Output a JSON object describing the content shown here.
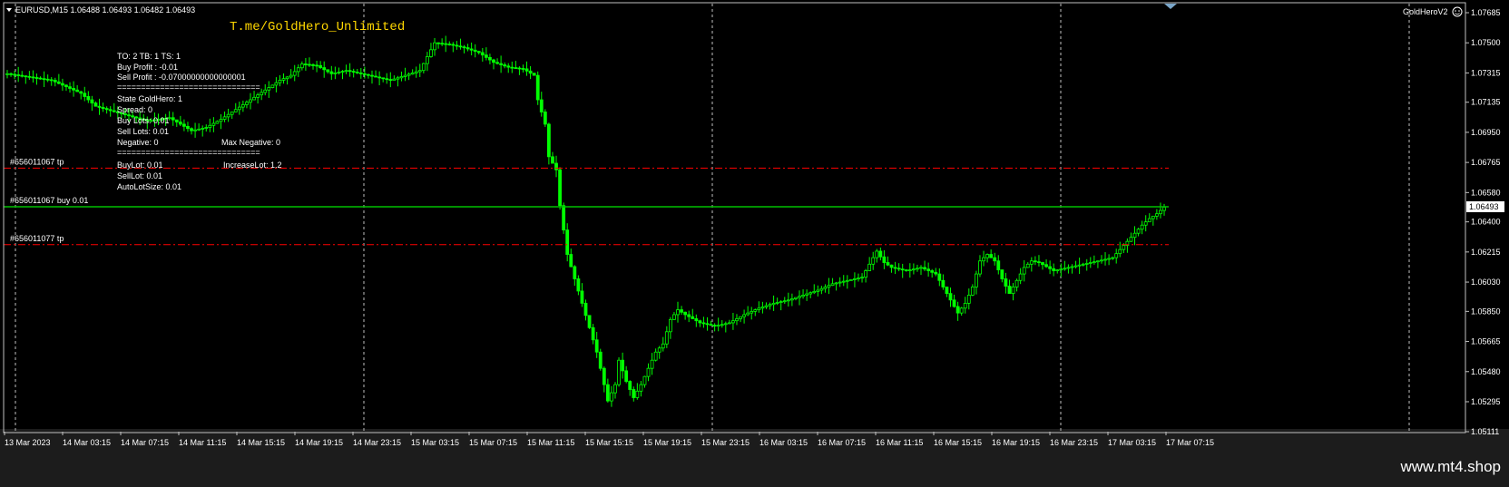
{
  "window": {
    "symbol_line": "EURUSD,M15  1.06488 1.06493 1.06482 1.06493",
    "watermark": "T.me/GoldHero_Unlimited",
    "ea_name": "GoldHeroV2",
    "footer": "www.mt4.shop"
  },
  "info_panel": {
    "lines": [
      {
        "text": "TO: 2        TB: 1        TS: 1"
      },
      {
        "text": "Buy Profit :  -0.01"
      },
      {
        "text": "Sell Profit : -0.07000000000000001"
      },
      {
        "text": "=============================="
      },
      {
        "text": "State GoldHero:  1"
      },
      {
        "text": "Spread:  0"
      },
      {
        "text": "Buy Lots:   0.01"
      },
      {
        "text": "Sell Lots:   0.01"
      },
      {
        "text": "Negative:   0",
        "extra": "Max Negative:   0"
      },
      {
        "text": "=============================="
      },
      {
        "text": "BuyLot:  0.01",
        "extra": "IncreaseLot:   1.2"
      },
      {
        "text": "SellLot:  0.01"
      },
      {
        "text": "AutoLotSize: 0.01"
      }
    ]
  },
  "colors": {
    "background": "#000000",
    "candle": "#00ff00",
    "tp_line": "#ff0000",
    "price_line": "#00c000",
    "grid": "#c0c0c0",
    "text": "#ffffff",
    "watermark": "#ffd700"
  },
  "chart_data": {
    "type": "candlestick",
    "symbol": "EURUSD",
    "timeframe": "M15",
    "ohlc_current": {
      "open": 1.06488,
      "high": 1.06493,
      "low": 1.06482,
      "close": 1.06493
    },
    "ylim": [
      1.05111,
      1.07685
    ],
    "y_ticks": [
      "1.07685",
      "1.07500",
      "1.07315",
      "1.07135",
      "1.06950",
      "1.06765",
      "1.06580",
      "1.06400",
      "1.06215",
      "1.06030",
      "1.05850",
      "1.05665",
      "1.05480",
      "1.05295",
      "1.05111"
    ],
    "x_ticks": [
      "13 Mar 2023",
      "14 Mar 03:15",
      "14 Mar 07:15",
      "14 Mar 11:15",
      "14 Mar 15:15",
      "14 Mar 19:15",
      "14 Mar 23:15",
      "15 Mar 03:15",
      "15 Mar 07:15",
      "15 Mar 11:15",
      "15 Mar 15:15",
      "15 Mar 19:15",
      "15 Mar 23:15",
      "16 Mar 03:15",
      "16 Mar 07:15",
      "16 Mar 11:15",
      "16 Mar 15:15",
      "16 Mar 19:15",
      "16 Mar 23:15",
      "17 Mar 03:15",
      "17 Mar 07:15"
    ],
    "current_price": "1.06493",
    "horizontal_lines": [
      {
        "label": "#656011067 tp",
        "price": 1.0673,
        "style": "dash-dot"
      },
      {
        "label": "#656011067 buy 0.01",
        "price": 1.06493,
        "style": "solid"
      },
      {
        "label": "#656011077 tp",
        "price": 1.0626,
        "style": "dash-dot"
      }
    ],
    "close_path": [
      [
        0,
        1.0731
      ],
      [
        12,
        1.0727
      ],
      [
        20,
        1.0719
      ],
      [
        24,
        1.0711
      ],
      [
        30,
        1.0707
      ],
      [
        38,
        1.0702
      ],
      [
        44,
        1.0704
      ],
      [
        50,
        1.0696
      ],
      [
        54,
        1.0698
      ],
      [
        58,
        1.0703
      ],
      [
        62,
        1.0709
      ],
      [
        66,
        1.0715
      ],
      [
        70,
        1.0721
      ],
      [
        74,
        1.0727
      ],
      [
        77,
        1.073
      ],
      [
        80,
        1.0737
      ],
      [
        84,
        1.0736
      ],
      [
        88,
        1.0731
      ],
      [
        92,
        1.0733
      ],
      [
        96,
        1.0731
      ],
      [
        100,
        1.0729
      ],
      [
        104,
        1.0727
      ],
      [
        108,
        1.073
      ],
      [
        112,
        1.0733
      ],
      [
        116,
        1.075
      ],
      [
        120,
        1.0749
      ],
      [
        124,
        1.0747
      ],
      [
        128,
        1.0744
      ],
      [
        132,
        1.0738
      ],
      [
        136,
        1.0735
      ],
      [
        140,
        1.0734
      ],
      [
        143,
        1.073
      ],
      [
        144,
        1.0715
      ],
      [
        146,
        1.07
      ],
      [
        147,
        1.068
      ],
      [
        149,
        1.0672
      ],
      [
        150,
        1.065
      ],
      [
        151,
        1.0635
      ],
      [
        152,
        1.062
      ],
      [
        154,
        1.0605
      ],
      [
        156,
        1.059
      ],
      [
        158,
        1.0575
      ],
      [
        160,
        1.056
      ],
      [
        162,
        1.054
      ],
      [
        163,
        1.053
      ],
      [
        165,
        1.054
      ],
      [
        166,
        1.0555
      ],
      [
        168,
        1.0542
      ],
      [
        170,
        1.0532
      ],
      [
        172,
        1.054
      ],
      [
        174,
        1.055
      ],
      [
        176,
        1.056
      ],
      [
        178,
        1.0565
      ],
      [
        180,
        1.058
      ],
      [
        182,
        1.0586
      ],
      [
        184,
        1.0583
      ],
      [
        188,
        1.0578
      ],
      [
        192,
        1.0576
      ],
      [
        196,
        1.0578
      ],
      [
        200,
        1.0583
      ],
      [
        204,
        1.0587
      ],
      [
        208,
        1.059
      ],
      [
        212,
        1.0592
      ],
      [
        216,
        1.0595
      ],
      [
        220,
        1.0598
      ],
      [
        224,
        1.0602
      ],
      [
        228,
        1.0604
      ],
      [
        232,
        1.0606
      ],
      [
        234,
        1.0614
      ],
      [
        236,
        1.0622
      ],
      [
        238,
        1.0615
      ],
      [
        240,
        1.0612
      ],
      [
        244,
        1.061
      ],
      [
        248,
        1.0612
      ],
      [
        252,
        1.0608
      ],
      [
        254,
        1.06
      ],
      [
        256,
        1.0592
      ],
      [
        258,
        1.0584
      ],
      [
        260,
        1.059
      ],
      [
        262,
        1.06
      ],
      [
        264,
        1.0616
      ],
      [
        266,
        1.062
      ],
      [
        268,
        1.0616
      ],
      [
        270,
        1.0605
      ],
      [
        272,
        1.0596
      ],
      [
        274,
        1.0604
      ],
      [
        276,
        1.0612
      ],
      [
        278,
        1.0616
      ],
      [
        280,
        1.0615
      ],
      [
        284,
        1.061
      ],
      [
        288,
        1.0612
      ],
      [
        292,
        1.0614
      ],
      [
        296,
        1.0616
      ],
      [
        300,
        1.0618
      ],
      [
        302,
        1.0623
      ],
      [
        304,
        1.0628
      ],
      [
        306,
        1.0633
      ],
      [
        308,
        1.0638
      ],
      [
        310,
        1.0642
      ],
      [
        312,
        1.0645
      ],
      [
        314,
        1.0649
      ]
    ]
  }
}
